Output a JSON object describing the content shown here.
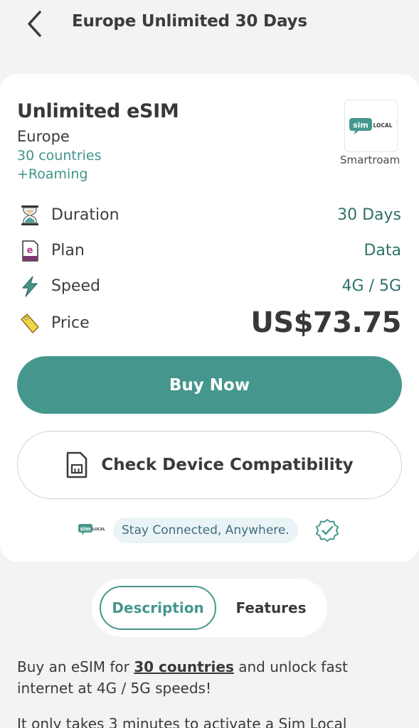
{
  "header": {
    "title": "Europe Unlimited 30 Days"
  },
  "product": {
    "title": "Unlimited eSIM",
    "region": "Europe",
    "countries": "30 countries",
    "roaming": "+Roaming",
    "provider_name": "Smartroam",
    "provider_logo_text": {
      "sim": "sim",
      "local": "LOCAL"
    }
  },
  "specs": {
    "duration": {
      "label": "Duration",
      "value": "30 Days",
      "icon": "hourglass-icon"
    },
    "plan": {
      "label": "Plan",
      "value": "Data",
      "icon": "esim-card-icon"
    },
    "speed": {
      "label": "Speed",
      "value": "4G / 5G",
      "icon": "lightning-icon"
    },
    "price": {
      "label": "Price",
      "value": "US$73.75",
      "icon": "price-tag-icon"
    }
  },
  "actions": {
    "buy_label": "Buy Now",
    "compat_label": "Check Device Compatibility"
  },
  "tagline": {
    "text": "Stay Connected, Anywhere."
  },
  "tabs": {
    "description": "Description",
    "features": "Features"
  },
  "description": {
    "p1_before": "Buy an eSIM for ",
    "p1_link": "30 countries",
    "p1_after": " and unlock fast internet at 4G / 5G speeds!",
    "p2": "It only takes 3 minutes to activate a Sim Local"
  },
  "colors": {
    "accent": "#45978d",
    "accent_text": "#2f7169",
    "background": "#f2f3f2",
    "card": "#ffffff"
  }
}
